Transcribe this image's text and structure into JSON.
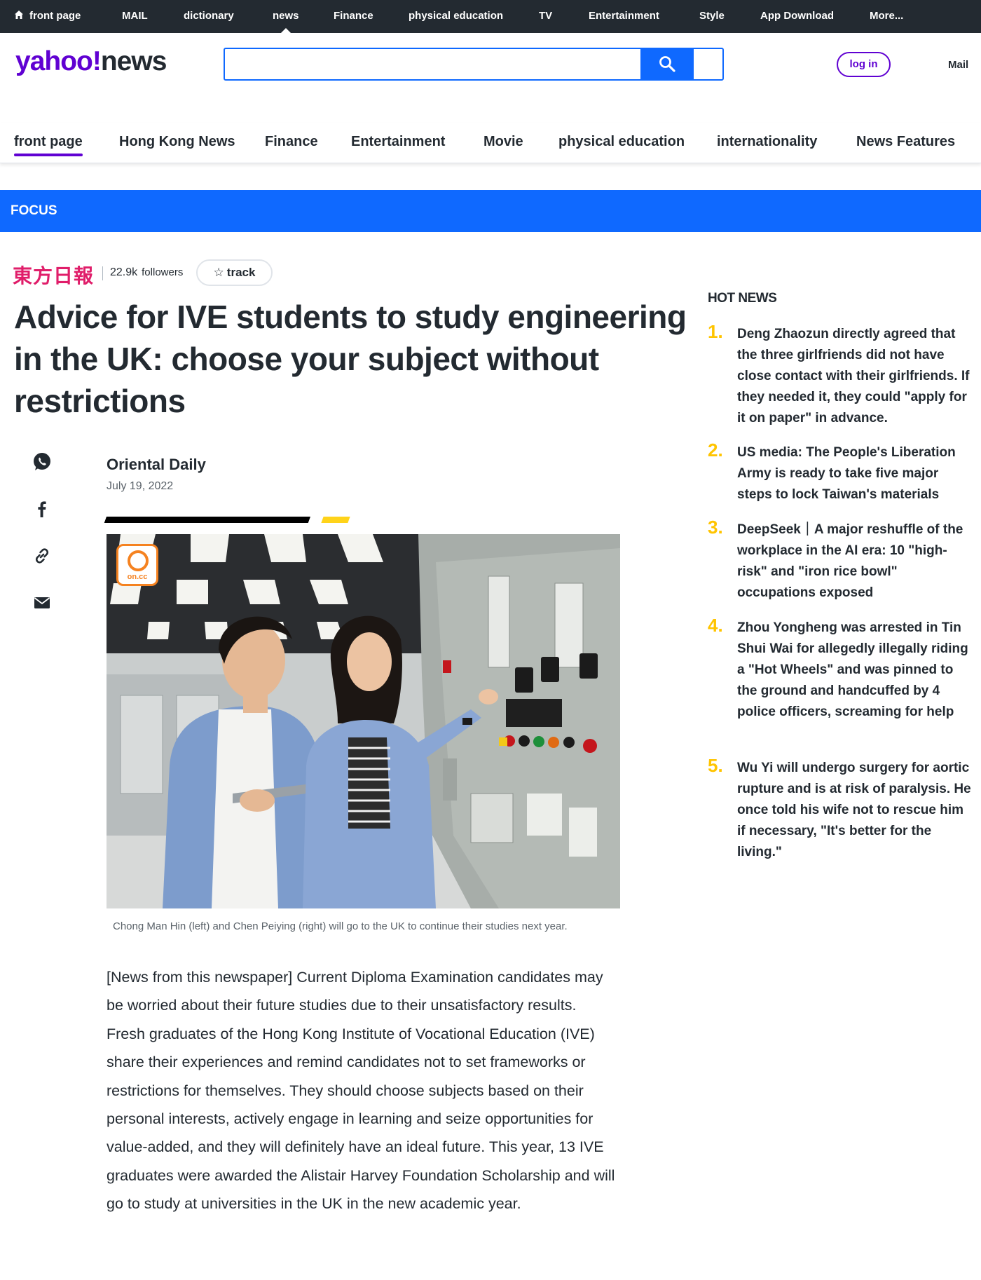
{
  "topnav": {
    "items": [
      "front page",
      "MAIL",
      "dictionary",
      "news",
      "Finance",
      "physical education",
      "TV",
      "Entertainment",
      "Style",
      "App Download",
      "More..."
    ],
    "active_index": 3
  },
  "header": {
    "logo_yahoo": "yahoo!",
    "logo_news": "news",
    "search_placeholder": "",
    "login_label": "log in",
    "mail_label": "Mail"
  },
  "subnav": {
    "tabs": [
      "front page",
      "Hong Kong News",
      "Finance",
      "Entertainment",
      "Movie",
      "physical education",
      "internationality",
      "News Features"
    ],
    "active_index": 0
  },
  "banner": {
    "label": "FOCUS"
  },
  "publisher": {
    "name": "東方日報",
    "followers_count": "22.9k",
    "followers_label": "followers",
    "track_label": "track"
  },
  "article": {
    "headline": "Advice for IVE students to study engineering in the UK: choose your subject without restrictions",
    "author": "Oriental Daily",
    "date": "July 19, 2022",
    "image_watermark": "on.cc",
    "caption": "Chong Man Hin  (left) and Chen Peiying (right) will go to the UK to continue their studies next year.",
    "body": "[News from this newspaper] Current Diploma Examination candidates may be worried about their future studies due to their unsatisfactory results. Fresh graduates of the Hong Kong Institute of Vocational Education (IVE) share their experiences and remind candidates not to set frameworks or restrictions for themselves. They should choose subjects based on their personal interests, actively engage in learning and seize opportunities for value-added, and they will definitely have an ideal future. This year, 13 IVE graduates were awarded the Alistair Harvey Foundation Scholarship and will go to study at universities in the UK in the new academic year."
  },
  "share_icons": [
    "whatsapp-icon",
    "facebook-icon",
    "link-icon",
    "email-icon"
  ],
  "hot_news": {
    "title": "HOT NEWS",
    "items": [
      {
        "num": "1.",
        "text": "Deng Zhaozun directly agreed that the three girlfriends did not have close contact with their girlfriends. If they needed it, they could \"apply for it on paper\" in advance."
      },
      {
        "num": "2.",
        "text": "US media: The People's Liberation Army is ready to take five major steps to lock Taiwan's materials"
      },
      {
        "num": "3.",
        "text": "DeepSeek｜A major reshuffle of the workplace in the AI era: 10 \"high-risk\" and \"iron rice bowl\" occupations exposed"
      },
      {
        "num": "4.",
        "text": "Zhou Yongheng was arrested in Tin Shui Wai for allegedly illegally riding a \"Hot Wheels\" and was pinned to the ground and handcuffed by 4 police officers, screaming for help"
      },
      {
        "num": "5.",
        "text": "Wu Yi will undergo surgery for aortic rupture and is at risk of paralysis. He once told his wife not to rescue him if necessary, \"It's better for the living.\""
      }
    ]
  },
  "colors": {
    "topbar": "#232a31",
    "brand_purple": "#6001d2",
    "brand_blue": "#0f69ff",
    "hot_num": "#ffc400",
    "publisher": "#e01e6a"
  }
}
